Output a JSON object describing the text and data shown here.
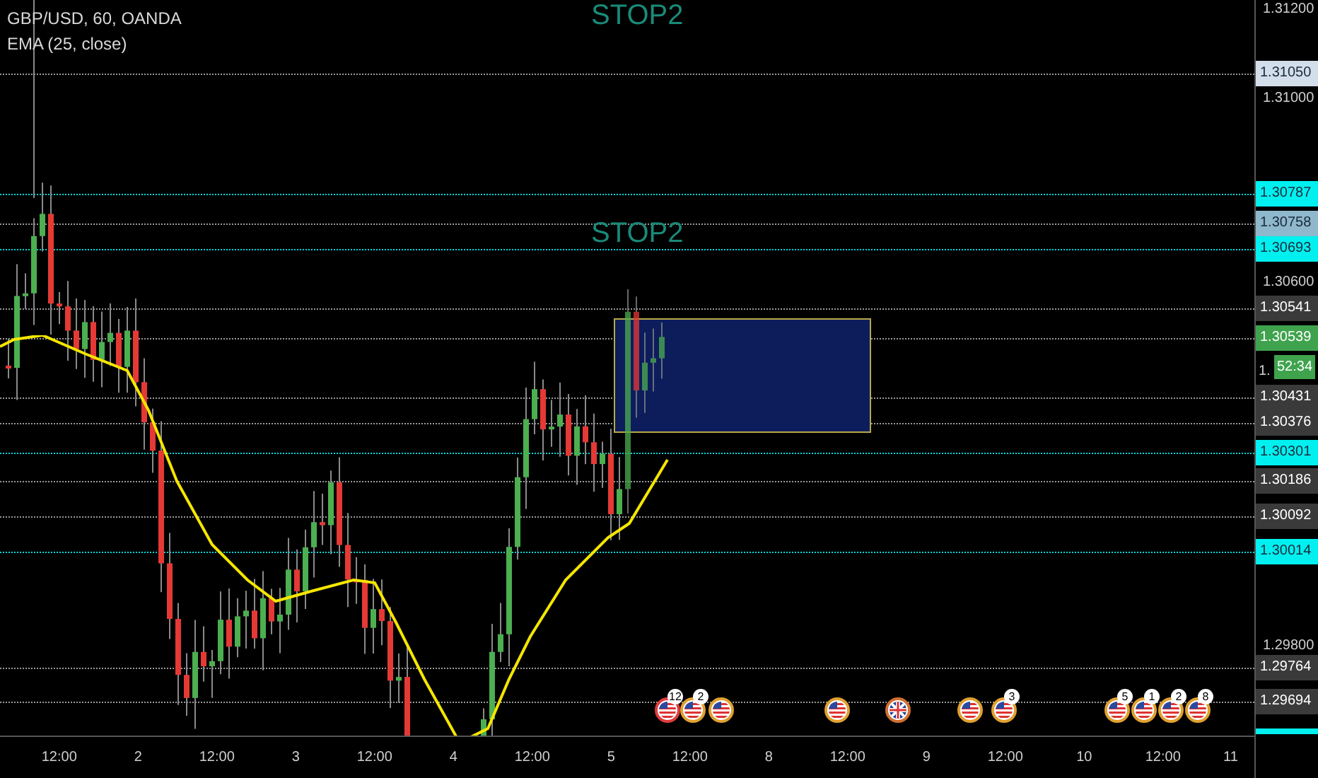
{
  "header": {
    "symbol": "GBP/USD, 60, OANDA",
    "indicator": "EMA (25, close)"
  },
  "annotations": [
    "STOP2",
    "STOP2"
  ],
  "price_axis": [
    {
      "kind": "tick",
      "label": "1.31200"
    },
    {
      "kind": "marker",
      "label": "1.31050",
      "color": "#d3deea"
    },
    {
      "kind": "tick",
      "label": "1.31000"
    },
    {
      "kind": "marker",
      "label": "1.30787",
      "color": "#00f0f0"
    },
    {
      "kind": "marker",
      "label": "1.30758",
      "color": "#8fb8cc"
    },
    {
      "kind": "marker",
      "label": "1.30693",
      "color": "#00f0f0"
    },
    {
      "kind": "tick",
      "label": "1.30600"
    },
    {
      "kind": "marker",
      "label": "1.30541",
      "color": "#3a3a3a"
    },
    {
      "kind": "marker",
      "label": "1.30539",
      "color": "#3fa34d"
    },
    {
      "kind": "countdown",
      "label": "1.",
      "time": "52:34",
      "color": "#3fa34d"
    },
    {
      "kind": "marker",
      "label": "1.30431",
      "color": "#3a3a3a"
    },
    {
      "kind": "marker",
      "label": "1.30376",
      "color": "#3a3a3a"
    },
    {
      "kind": "marker",
      "label": "1.30301",
      "color": "#00f0f0"
    },
    {
      "kind": "marker",
      "label": "1.30186",
      "color": "#3a3a3a"
    },
    {
      "kind": "marker",
      "label": "1.30092",
      "color": "#3a3a3a"
    },
    {
      "kind": "marker",
      "label": "1.30014",
      "color": "#00f0f0"
    },
    {
      "kind": "tick",
      "label": "1.29800"
    },
    {
      "kind": "marker",
      "label": "1.29764",
      "color": "#3a3a3a"
    },
    {
      "kind": "marker",
      "label": "1.29694",
      "color": "#3a3a3a"
    }
  ],
  "time_axis": [
    "12:00",
    "2",
    "12:00",
    "3",
    "12:00",
    "4",
    "12:00",
    "5",
    "12:00",
    "8",
    "12:00",
    "9",
    "12:00",
    "10",
    "12:00",
    "11"
  ],
  "events": [
    {
      "kind": "us",
      "color": "#e03b3b",
      "badge": "12"
    },
    {
      "kind": "us",
      "color": "#e0a030",
      "badge": "2"
    },
    {
      "kind": "us",
      "color": "#e0a030"
    },
    {
      "kind": "us",
      "color": "#e0a030"
    },
    {
      "kind": "uk",
      "color": "#d07030"
    },
    {
      "kind": "us",
      "color": "#e0a030"
    },
    {
      "kind": "us",
      "color": "#e0a030",
      "badge": "3"
    },
    {
      "kind": "us",
      "color": "#e0a030",
      "badge": "5"
    },
    {
      "kind": "us",
      "color": "#e0a030",
      "badge": "1"
    },
    {
      "kind": "us",
      "color": "#e0a030",
      "badge": "2"
    },
    {
      "kind": "us",
      "color": "#e0a030",
      "badge": "8"
    }
  ]
}
